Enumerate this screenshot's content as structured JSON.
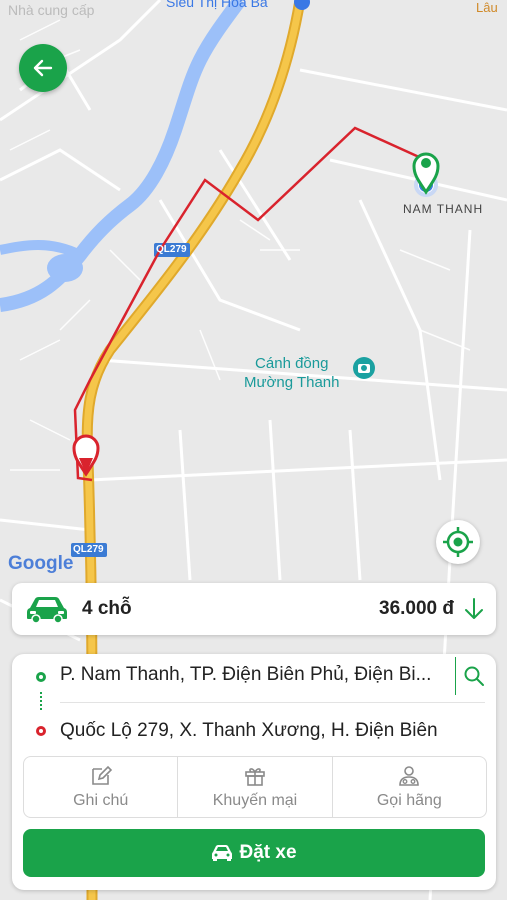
{
  "map": {
    "status_left": "Nhà cung cấp",
    "poi_top": "Siêu Thị Hoà Bá",
    "poi_top_right": "Lâu",
    "road_label_1": "QL279",
    "road_label_2": "QL279",
    "place_nam_thanh": "NAM THANH",
    "place_field_line1": "Cánh đồng",
    "place_field_line2": "Mường Thanh",
    "google_logo": "Google"
  },
  "car": {
    "type_label": "4 chỗ",
    "price": "36.000 đ"
  },
  "trip": {
    "pickup": "P. Nam Thanh, TP. Điện Biên Phủ, Điện Bi...",
    "dropoff": "Quốc Lộ 279, X. Thanh Xương, H. Điện Biên"
  },
  "actions": [
    {
      "label": "Ghi chú",
      "icon": "edit-icon"
    },
    {
      "label": "Khuyến mại",
      "icon": "gift-icon"
    },
    {
      "label": "Gọi hãng",
      "icon": "operator-icon"
    }
  ],
  "book_button": "Đặt xe",
  "colors": {
    "brand": "#1aa34a",
    "route": "#d9232d",
    "highway": "#f5c64a"
  }
}
